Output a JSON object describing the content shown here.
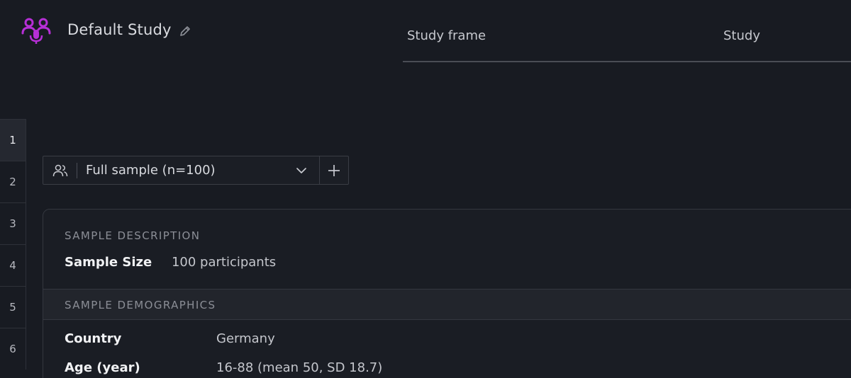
{
  "header": {
    "study_title": "Default Study",
    "tabs": [
      {
        "label": "Study frame"
      },
      {
        "label": "Study"
      }
    ]
  },
  "rail": {
    "steps": [
      "1",
      "2",
      "3",
      "4",
      "5",
      "6"
    ],
    "active": "1"
  },
  "selector": {
    "label": "Full sample (n=100)"
  },
  "card": {
    "description_title": "SAMPLE DESCRIPTION",
    "sample_size_label": "Sample Size",
    "sample_size_value": "100 participants",
    "demographics_title": "SAMPLE DEMOGRAPHICS",
    "demographics": [
      {
        "label": "Country",
        "value": "Germany"
      },
      {
        "label": "Age (year)",
        "value": "16-88 (mean 50, SD 18.7)"
      }
    ]
  },
  "colors": {
    "background": "#181b22",
    "brand_accent": "#b62fd6"
  },
  "icons": {
    "logo": "users-mic-icon",
    "edit": "pencil-icon",
    "users": "users-icon",
    "chevron": "chevron-down-icon",
    "add": "plus-icon"
  }
}
